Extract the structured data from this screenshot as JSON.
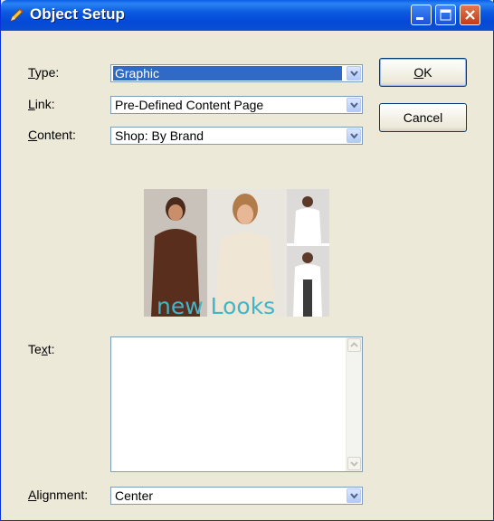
{
  "window": {
    "title": "Object Setup",
    "title_icon": "pencil-icon"
  },
  "titlebar_buttons": {
    "minimize": "minimize-icon",
    "maximize": "maximize-icon",
    "close": "close-icon"
  },
  "fields": {
    "type": {
      "label_underlined": "T",
      "label_rest": "ype:",
      "value": "Graphic"
    },
    "link": {
      "label_underlined": "L",
      "label_rest": "ink:",
      "value": "Pre-Defined Content Page"
    },
    "content": {
      "label_underlined": "C",
      "label_rest": "ontent:",
      "value": "Shop: By Brand"
    },
    "text": {
      "label_before": "Te",
      "label_underlined": "x",
      "label_after": "t:",
      "value": ""
    },
    "alignment": {
      "label_underlined": "A",
      "label_rest": "lignment:",
      "value": "Center"
    }
  },
  "buttons": {
    "ok": {
      "label_underlined": "O",
      "label_rest": "K"
    },
    "cancel": {
      "label": "Cancel"
    }
  },
  "preview": {
    "caption": "new Looks"
  },
  "colors": {
    "titlebar": "#0a5ee8",
    "dialog_bg": "#ece9d8",
    "selection": "#316ac5",
    "caption": "#3fb6c9"
  }
}
